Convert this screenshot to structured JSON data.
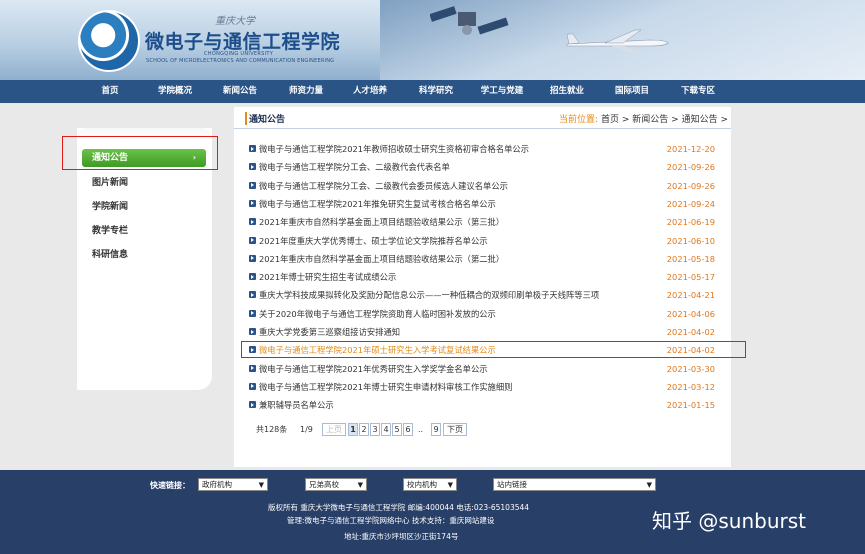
{
  "header": {
    "site_title": "微电子与通信工程学院",
    "university_script": "重庆大学",
    "university_en": "CHONGQING UNIVERSITY",
    "college_en": "SCHOOL OF MICROELECTRONICS AND COMMUNICATION ENGINEERING"
  },
  "nav": {
    "items": [
      "首页",
      "学院概况",
      "新闻公告",
      "师资力量",
      "人才培养",
      "科学研究",
      "学工与党建",
      "招生就业",
      "国际项目",
      "下载专区"
    ]
  },
  "sidebar": {
    "items": [
      {
        "label": "通知公告",
        "active": true,
        "arrow": "›"
      },
      {
        "label": "图片新闻"
      },
      {
        "label": "学院新闻"
      },
      {
        "label": "教学专栏"
      },
      {
        "label": "科研信息"
      }
    ]
  },
  "content": {
    "section_title": "通知公告",
    "breadcrumb": {
      "label": "当前位置:",
      "home": "首页",
      "sep": ">",
      "news": "新闻公告",
      "current": "通知公告"
    },
    "rows": [
      {
        "title": "微电子与通信工程学院2021年教师招收硕士研究生资格初审合格名单公示",
        "date": "2021-12-20"
      },
      {
        "title": "微电子与通信工程学院分工会、二级教代会代表名单",
        "date": "2021-09-26"
      },
      {
        "title": "微电子与通信工程学院分工会、二级教代会委员候选人建议名单公示",
        "date": "2021-09-26"
      },
      {
        "title": "微电子与通信工程学院2021年推免研究生复试考核合格名单公示",
        "date": "2021-09-24"
      },
      {
        "title": "2021年重庆市自然科学基金面上项目结题验收结果公示（第三批）",
        "date": "2021-06-19"
      },
      {
        "title": "2021年度重庆大学优秀博士、硕士学位论文学院推荐名单公示",
        "date": "2021-06-10"
      },
      {
        "title": "2021年重庆市自然科学基金面上项目结题验收结果公示（第二批）",
        "date": "2021-05-18"
      },
      {
        "title": "2021年博士研究生招生考试成绩公示",
        "date": "2021-05-17"
      },
      {
        "title": "重庆大学科技成果拟转化及奖励分配信息公示——一种低耦合的双频印刷单极子天线阵等三项",
        "date": "2021-04-21"
      },
      {
        "title": "关于2020年微电子与通信工程学院资助育人临时困补发放的公示",
        "date": "2021-04-06"
      },
      {
        "title": "重庆大学党委第三巡察组接访安排通知",
        "date": "2021-04-02"
      },
      {
        "title": "微电子与通信工程学院2021年硕士研究生入学考试复试结果公示",
        "date": "2021-04-02",
        "highlight": true
      },
      {
        "title": "微电子与通信工程学院2021年优秀研究生入学奖学金名单公示",
        "date": "2021-03-30"
      },
      {
        "title": "微电子与通信工程学院2021年博士研究生申请材料审核工作实施细则",
        "date": "2021-03-12"
      },
      {
        "title": "兼职辅导员名单公示",
        "date": "2021-01-15"
      }
    ],
    "pager": {
      "total": "共128条",
      "page_of": "1/9",
      "prev": "上页",
      "pages": [
        "1",
        "2",
        "3",
        "4",
        "5",
        "6"
      ],
      "ellipsis": "..",
      "last": "9",
      "next": "下页"
    }
  },
  "footer": {
    "quick_label": "快速链接：",
    "selects": [
      "政府机构",
      "兄弟高校",
      "校内机构",
      "站内链接"
    ],
    "line1": "版权所有  重庆大学微电子与通信工程学院   邮编:400044  电话:023-65103544",
    "line2": "管理:微电子与通信工程学院网络中心      技术支持：重庆网站建设",
    "line3": "地址:重庆市沙坪坝区沙正街174号",
    "watermark": "知乎 @sunburst"
  },
  "colors": {
    "nav_bg": "#2b5486",
    "footer_bg": "#283f68",
    "accent_orange": "#e38b1a",
    "active_green": "#3d9a22",
    "annotation_red": "#e01b1b"
  }
}
